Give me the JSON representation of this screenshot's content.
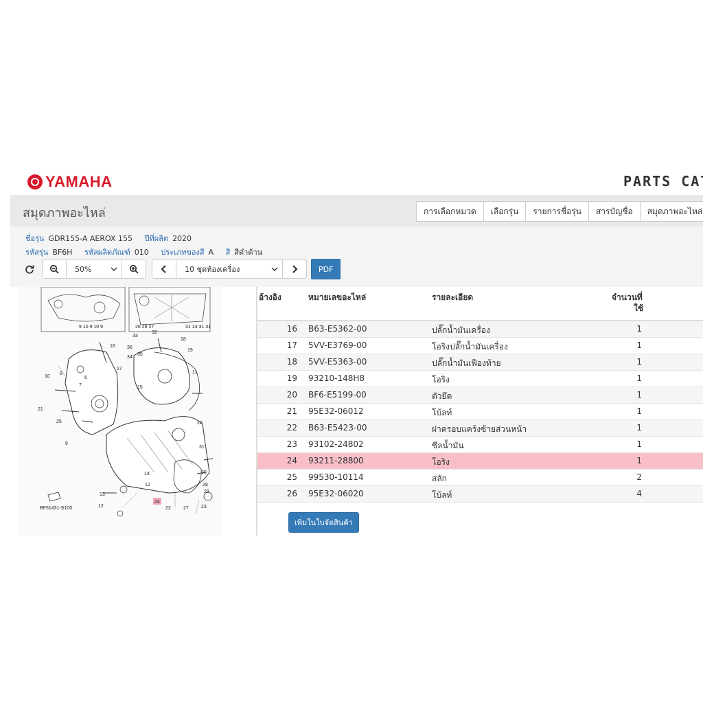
{
  "brand": {
    "logo_text": "YAMAHA",
    "catalog_title": "PARTS CATA"
  },
  "nav": {
    "page_title": "สมุดภาพอะไหล่",
    "tabs": [
      "การเลือกหมวด",
      "เลือกรุ่น",
      "รายการชื่อรุ่น",
      "สารบัญชื่อ",
      "สมุดภาพอะไหล่"
    ]
  },
  "info": {
    "model_label": "ชื่อรุ่น",
    "model_value": "GDR155-A AEROX 155",
    "year_label": "ปีที่ผลิต",
    "year_value": "2020",
    "code_label": "รหัสรุ่น",
    "code_value": "BF6H",
    "product_code_label": "รหัสผลิตภัณฑ์",
    "product_code_value": "010",
    "color_type_label": "ประเภทของสี",
    "color_type_value": "A",
    "color_label": "สี",
    "color_value": "สีดำด้าน"
  },
  "toolbar": {
    "zoom_value": "50%",
    "section_value": "10 ชุดห้องเครื่อง",
    "pdf_label": "PDF"
  },
  "diagram": {
    "figure_code": "BF61431-S100",
    "highlight_ref": "24",
    "callouts": [
      "16",
      "33",
      "32",
      "18",
      "19",
      "36",
      "17",
      "35",
      "10",
      "8",
      "6",
      "7",
      "21",
      "25",
      "34",
      "11",
      "15",
      "31",
      "20",
      "22",
      "13",
      "12",
      "14",
      "24",
      "26",
      "27",
      "23",
      "9",
      "30",
      "28",
      "29"
    ]
  },
  "table": {
    "headers": {
      "ref": "อ้างอิง",
      "part": "หมายเลขอะไหล่",
      "desc": "รายละเอียด",
      "qty_line1": "จำนวนที่",
      "qty_line2": "ใช้"
    },
    "rows": [
      {
        "ref": "16",
        "part": "B63-E5362-00",
        "desc": "ปลั๊กน้ำมันเครื่อง",
        "qty": "1"
      },
      {
        "ref": "17",
        "part": "5VV-E3769-00",
        "desc": "โอริงปลั๊กน้ำมันเครื่อง",
        "qty": "1"
      },
      {
        "ref": "18",
        "part": "5VV-E5363-00",
        "desc": "ปลั๊กน้ำมันเฟืองท้าย",
        "qty": "1"
      },
      {
        "ref": "19",
        "part": "93210-148H8",
        "desc": "โอริง",
        "qty": "1"
      },
      {
        "ref": "20",
        "part": "BF6-E5199-00",
        "desc": "ตัวยึด",
        "qty": "1"
      },
      {
        "ref": "21",
        "part": "95E32-06012",
        "desc": "โบ้ลท์",
        "qty": "1"
      },
      {
        "ref": "22",
        "part": "B63-E5423-00",
        "desc": "ฝาครอบแคร้งซ้ายส่วนหน้า",
        "qty": "1"
      },
      {
        "ref": "23",
        "part": "93102-24802",
        "desc": "ซีลน้ำมัน",
        "qty": "1"
      },
      {
        "ref": "24",
        "part": "93211-28800",
        "desc": "โอริง",
        "qty": "1"
      },
      {
        "ref": "25",
        "part": "99530-10114",
        "desc": "สลัก",
        "qty": "2"
      },
      {
        "ref": "26",
        "part": "95E32-06020",
        "desc": "โบ้ลท์",
        "qty": "4"
      }
    ],
    "add_button_label": "เพิ่มในใบจัดสินค้า"
  },
  "colors": {
    "brand_red": "#d7182a",
    "primary_blue": "#337ab7",
    "highlight_row": "#f8bfc9"
  }
}
